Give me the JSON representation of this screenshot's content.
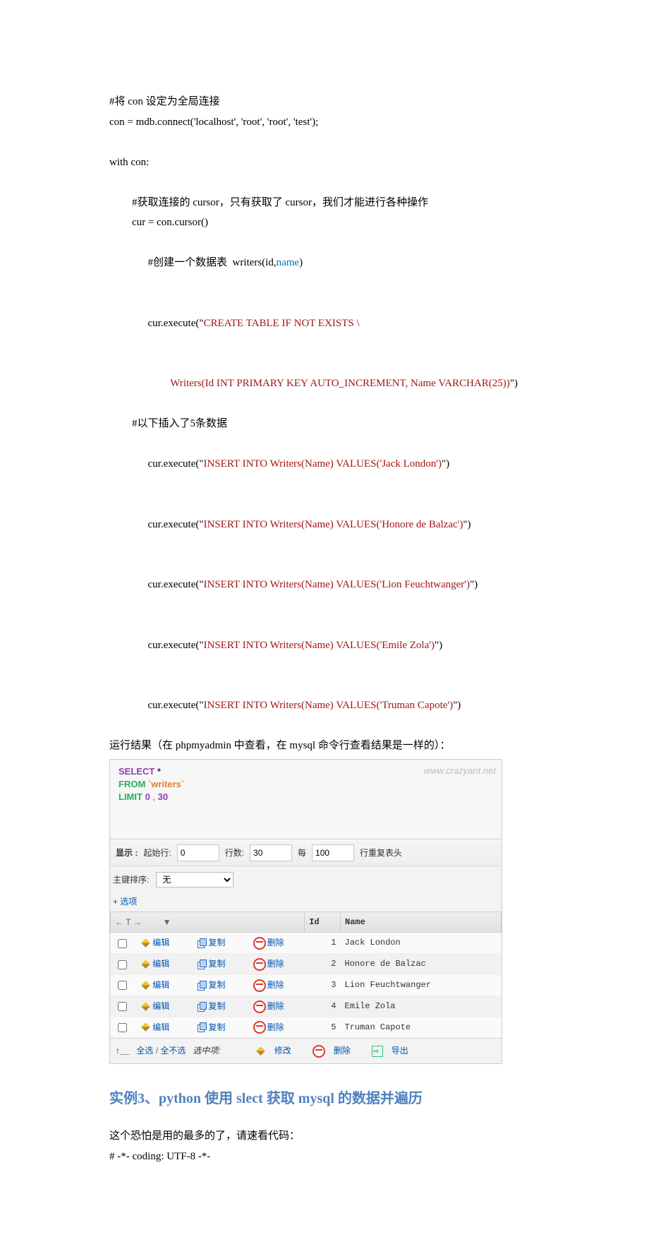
{
  "code_block1": {
    "l1": "#将 con 设定为全局连接",
    "l2": "con = mdb.connect('localhost', 'root', 'root', 'test');",
    "l3": "with con:",
    "l4": "#获取连接的 cursor，只有获取了 cursor，我们才能进行各种操作",
    "l5": "cur = con.cursor()",
    "l6a": "#创建一个数据表  writers(id,",
    "l6b": "name",
    "l6c": ")",
    "l7a": "cur.execute(\"",
    "l7b": "CREATE TABLE IF NOT EXISTS \\",
    "l8": "Writers(Id INT PRIMARY KEY AUTO_INCREMENT, Name VARCHAR(25))",
    "l8end": "\")",
    "l9": "#以下插入了5条数据",
    "l10b": "INSERT INTO Writers(Name) VALUES('Jack London')",
    "l11b": "INSERT INTO Writers(Name) VALUES('Honore de Balzac')",
    "l12b": "INSERT INTO Writers(Name) VALUES('Lion Feuchtwanger')",
    "l13b": "INSERT INTO Writers(Name) VALUES('Emile Zola')",
    "l14b": "INSERT INTO Writers(Name) VALUES('Truman Capote')",
    "exec_end": "\")"
  },
  "result_caption": "运行结果（在 phpmyadmin 中查看，在 mysql 命令行查看结果是一样的）：",
  "pma": {
    "watermark": "www.crazyant.net",
    "sql": {
      "select": "SELECT",
      "star": "*",
      "from": "FROM",
      "table": "`writers`",
      "limit": "LIMIT",
      "n1": "0",
      "comma": " , ",
      "n2": "30"
    },
    "toolbar": {
      "display": "显示 :",
      "start_label": "起始行:",
      "start_val": "0",
      "rows_label": "行数:",
      "rows_val": "30",
      "per_label": "每",
      "per_val": "100",
      "repeat_label": "行重复表头"
    },
    "sort_label": "主键排序:",
    "sort_value": "无",
    "options_link": "+ 选项",
    "header": {
      "arrows": "← T →",
      "dropdown": "▼",
      "id": "Id",
      "name": "Name"
    },
    "actions": {
      "edit": "编辑",
      "copy": "复制",
      "delete": "删除"
    },
    "rows": [
      {
        "id": "1",
        "name": "Jack London"
      },
      {
        "id": "2",
        "name": "Honore de Balzac"
      },
      {
        "id": "3",
        "name": "Lion Feuchtwanger"
      },
      {
        "id": "4",
        "name": "Emile Zola"
      },
      {
        "id": "5",
        "name": "Truman Capote"
      }
    ],
    "footer": {
      "arrow": "↑__",
      "select_all": "全选",
      "slash": " / ",
      "deselect_all": "全不选",
      "with_selected": "选中项:",
      "edit": "修改",
      "delete": "删除",
      "export": "导出"
    }
  },
  "heading": "实例3、python 使用 slect 获取 mysql 的数据并遍历",
  "after_heading": {
    "l1": "这个恐怕是用的最多的了，请速看代码：",
    "l2": "# -*- coding: UTF-8 -*-"
  }
}
